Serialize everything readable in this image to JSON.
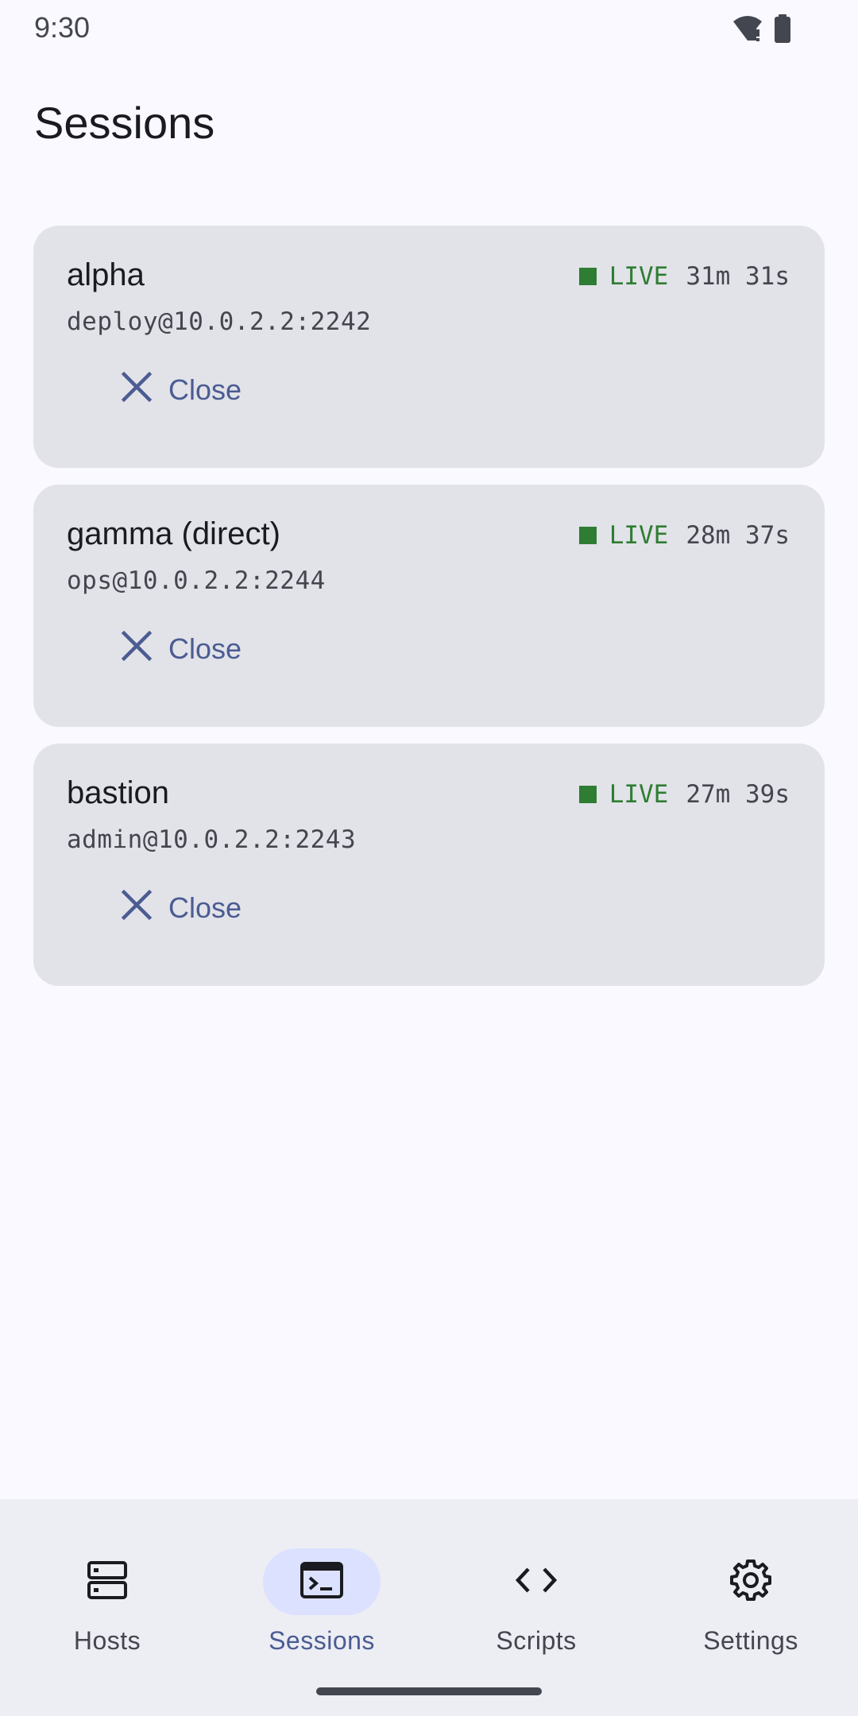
{
  "status_bar": {
    "time": "9:30",
    "icons": [
      "wifi-alert-icon",
      "battery-icon"
    ]
  },
  "page": {
    "title": "Sessions"
  },
  "sessions": [
    {
      "name": "alpha",
      "address": "deploy@10.0.2.2:2242",
      "status": "LIVE",
      "elapsed": "31m 31s",
      "close_label": "Close"
    },
    {
      "name": "gamma (direct)",
      "address": "ops@10.0.2.2:2244",
      "status": "LIVE",
      "elapsed": "28m 37s",
      "close_label": "Close"
    },
    {
      "name": "bastion",
      "address": "admin@10.0.2.2:2243",
      "status": "LIVE",
      "elapsed": "27m 39s",
      "close_label": "Close"
    }
  ],
  "bottom_nav": {
    "items": [
      {
        "label": "Hosts",
        "icon": "hosts-icon",
        "selected": false
      },
      {
        "label": "Sessions",
        "icon": "terminal-icon",
        "selected": true
      },
      {
        "label": "Scripts",
        "icon": "code-icon",
        "selected": false
      },
      {
        "label": "Settings",
        "icon": "gear-icon",
        "selected": false
      }
    ]
  },
  "colors": {
    "background": "#f9f9ff",
    "card": "#e2e2e9",
    "live": "#2e7d32",
    "accent": "#4a5c92",
    "nav_active_pill": "#dce1ff"
  }
}
